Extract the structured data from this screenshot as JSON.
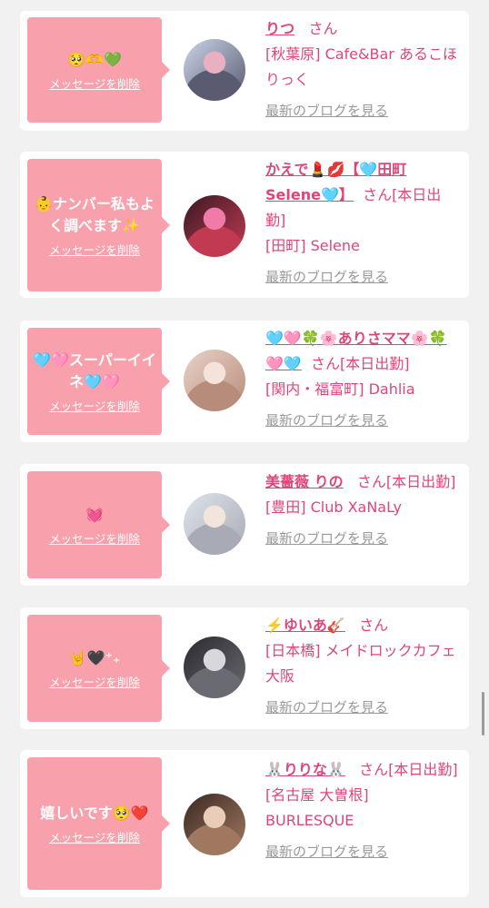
{
  "items": [
    {
      "message": "🥺🫶💚",
      "delete_label": "メッセージを削除",
      "name": "りつ",
      "suffix": "さん",
      "shop": "[秋葉原] Cafe&Bar あるこほりっく",
      "blog_label": "最新のブログを見る",
      "avatar_colors": [
        "#c9d4e8",
        "#5a5a70",
        "#e8b0c0"
      ]
    },
    {
      "message": "👶ナンバー私もよく調べます✨",
      "delete_label": "メッセージを削除",
      "name": "かえで💄💋【🩵田町Selene🩵】",
      "suffix": "さん[本日出勤]",
      "shop": "[田町] Selene",
      "blog_label": "最新のブログを見る",
      "avatar_colors": [
        "#3a1a22",
        "#c23a52",
        "#f07aa8"
      ]
    },
    {
      "message": "🩵🩷スーパーイイネ🩵🩷",
      "delete_label": "メッセージを削除",
      "name": "🩵🩷🍀🌸ありさママ🌸🍀🩷🩵",
      "suffix": "さん[本日出勤]",
      "shop": "[関内・福富町] Dahlia",
      "blog_label": "最新のブログを見る",
      "avatar_colors": [
        "#e8d2c8",
        "#b88c7a",
        "#f5e2da"
      ]
    },
    {
      "message": "💓",
      "delete_label": "メッセージを削除",
      "name": "美薔薇 りの",
      "suffix": "さん[本日出勤]",
      "shop": "[豊田] Club XaNaLy",
      "blog_label": "最新のブログを見る",
      "avatar_colors": [
        "#dfe3ea",
        "#a8aab5",
        "#f2e6dc"
      ]
    },
    {
      "message": "🤘🖤⁺₊",
      "delete_label": "メッセージを削除",
      "name": "⚡️ゆいあ🎸",
      "suffix": "さん",
      "shop": "[日本橋] メイドロックカフェ 大阪",
      "blog_label": "最新のブログを見る",
      "avatar_colors": [
        "#2a2a2e",
        "#6a6a72",
        "#d8d8dc"
      ]
    },
    {
      "message": "嬉しいです🥺❤️",
      "delete_label": "メッセージを削除",
      "name": "🐰りりな🐰",
      "suffix": "さん[本日出勤]",
      "shop": "[名古屋 大曽根] BURLESQUE",
      "blog_label": "最新のブログを見る",
      "avatar_colors": [
        "#3a2a22",
        "#a07860",
        "#e8cdb8"
      ]
    }
  ]
}
